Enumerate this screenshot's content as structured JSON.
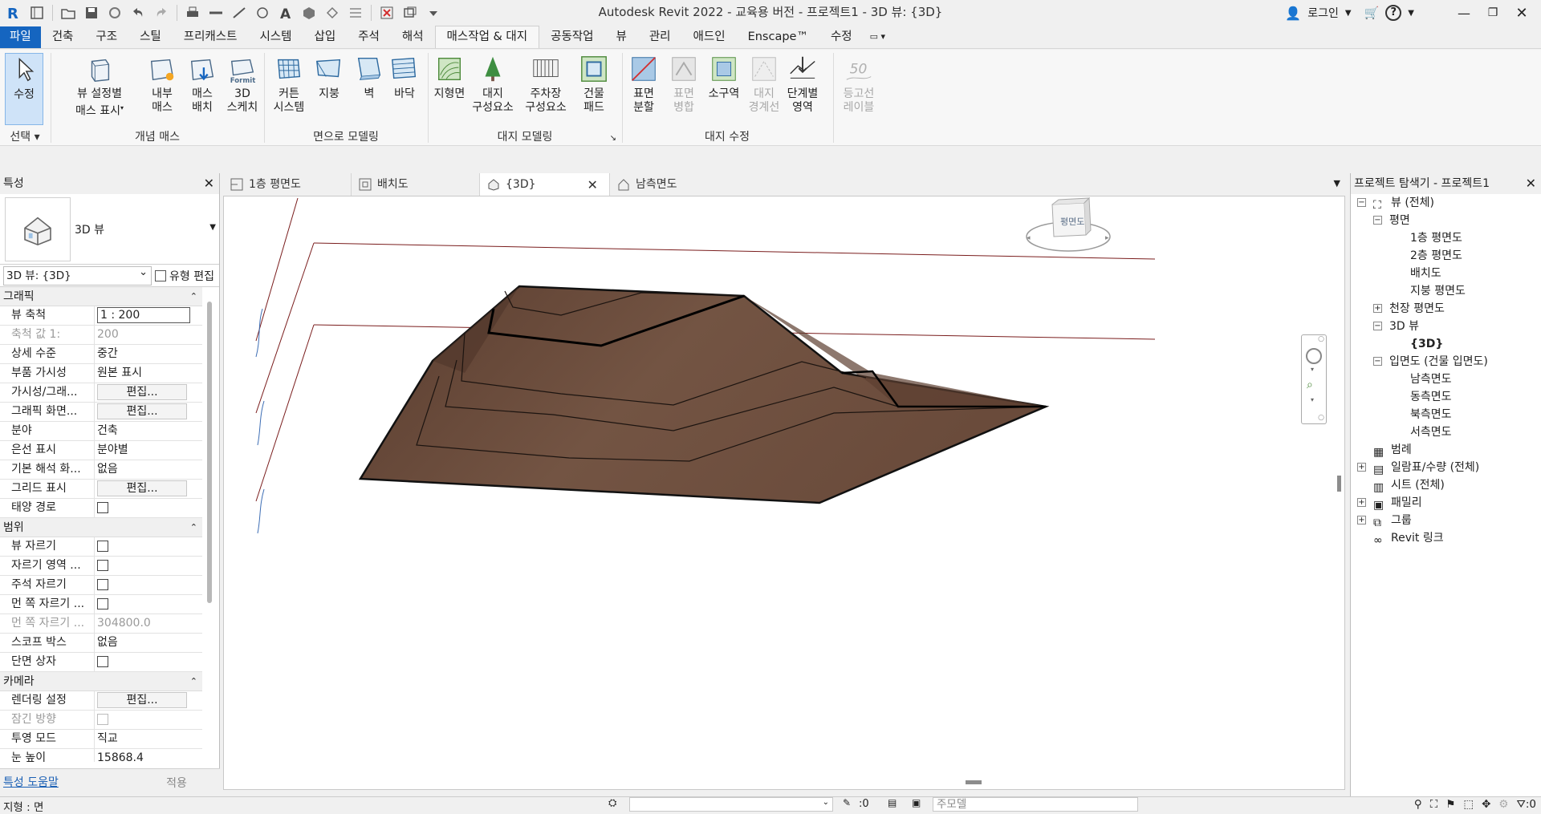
{
  "app": {
    "title": "Autodesk Revit 2022 - 교육용 버전 - 프로젝트1 - 3D 뷰: {3D}",
    "login_label": "로그인"
  },
  "quick_access": {
    "icons": [
      "revit-logo-icon",
      "home-icon",
      "open-icon",
      "save-icon",
      "sync-icon",
      "undo-icon",
      "redo-icon",
      "print-icon",
      "measure-icon",
      "dimension-icon",
      "tag-icon",
      "text-icon",
      "3d-view-icon",
      "section-icon",
      "thin-lines-icon",
      "close-hidden-icon",
      "switch-windows-icon",
      "customize-icon"
    ]
  },
  "ribbon_tabs": [
    "파일",
    "건축",
    "구조",
    "스틸",
    "프리캐스트",
    "시스템",
    "삽입",
    "주석",
    "해석",
    "매스작업 & 대지",
    "공동작업",
    "뷰",
    "관리",
    "애드인",
    "Enscape™",
    "수정"
  ],
  "active_tab": "매스작업 & 대지",
  "ribbon": {
    "select": {
      "modify_label": "수정",
      "panel_label": "선택"
    },
    "conceptual_mass": {
      "panel_label": "개념 매스",
      "buttons": [
        {
          "label": "뷰 설정별 매스 표시",
          "line1": "뷰 설정별",
          "line2": "매스 표시"
        },
        {
          "line1": "내부",
          "line2": "매스"
        },
        {
          "line1": "매스",
          "line2": "배치"
        },
        {
          "line1": "3D",
          "line2": "스케치"
        }
      ]
    },
    "model_by_face": {
      "panel_label": "면으로 모델링",
      "buttons": [
        {
          "line1": "커튼",
          "line2": "시스템"
        },
        {
          "line1": "지붕",
          "line2": ""
        },
        {
          "line1": "벽",
          "line2": ""
        },
        {
          "line1": "바닥",
          "line2": ""
        }
      ]
    },
    "site_modeling": {
      "panel_label": "대지 모델링",
      "buttons": [
        {
          "line1": "지형면",
          "line2": ""
        },
        {
          "line1": "대지",
          "line2": "구성요소"
        },
        {
          "line1": "주차장",
          "line2": "구성요소"
        },
        {
          "line1": "건물",
          "line2": "패드"
        }
      ]
    },
    "modify_site": {
      "panel_label": "대지 수정",
      "buttons": [
        {
          "line1": "표면",
          "line2": "분할",
          "disabled": false
        },
        {
          "line1": "표면",
          "line2": "병합",
          "disabled": true
        },
        {
          "line1": "소구역",
          "line2": "",
          "disabled": false
        },
        {
          "line1": "대지",
          "line2": "경계선",
          "disabled": true
        },
        {
          "line1": "단계별",
          "line2": "영역",
          "disabled": false
        },
        {
          "line1": "등고선",
          "line2": "레이블",
          "disabled": true
        }
      ]
    }
  },
  "properties": {
    "header": "특성",
    "type_name": "3D 뷰",
    "selector": "3D 뷰: {3D}",
    "edit_type": "유형 편집",
    "groups": [
      {
        "name": "그래픽",
        "rows": [
          {
            "key": "뷰 축척",
            "value": "1 : 200",
            "kind": "input"
          },
          {
            "key": "축척 값    1:",
            "value": "200",
            "kind": "text",
            "dim": true
          },
          {
            "key": "상세 수준",
            "value": "중간",
            "kind": "text"
          },
          {
            "key": "부품 가시성",
            "value": "원본 표시",
            "kind": "text"
          },
          {
            "key": "가시성/그래...",
            "value": "편집...",
            "kind": "button"
          },
          {
            "key": "그래픽 화면...",
            "value": "편집...",
            "kind": "button"
          },
          {
            "key": "분야",
            "value": "건축",
            "kind": "text"
          },
          {
            "key": "은선 표시",
            "value": "분야별",
            "kind": "text"
          },
          {
            "key": "기본 해석 화...",
            "value": "없음",
            "kind": "text"
          },
          {
            "key": "그리드 표시",
            "value": "편집...",
            "kind": "button"
          },
          {
            "key": "태양 경로",
            "value": "",
            "kind": "check"
          }
        ]
      },
      {
        "name": "범위",
        "rows": [
          {
            "key": "뷰 자르기",
            "value": "",
            "kind": "check"
          },
          {
            "key": "자르기 영역 ...",
            "value": "",
            "kind": "check"
          },
          {
            "key": "주석 자르기",
            "value": "",
            "kind": "check"
          },
          {
            "key": "먼 쪽 자르기 ...",
            "value": "",
            "kind": "check"
          },
          {
            "key": "먼 쪽 자르기 ...",
            "value": "304800.0",
            "kind": "text",
            "dim": true
          },
          {
            "key": "스코프 박스",
            "value": "없음",
            "kind": "text"
          },
          {
            "key": "단면 상자",
            "value": "",
            "kind": "check"
          }
        ]
      },
      {
        "name": "카메라",
        "rows": [
          {
            "key": "렌더링 설정",
            "value": "편집...",
            "kind": "button"
          },
          {
            "key": "잠긴 방향",
            "value": "",
            "kind": "checkdis",
            "dim": true
          },
          {
            "key": "투영 모드",
            "value": "직교",
            "kind": "text"
          },
          {
            "key": "눈 높이",
            "value": "15868.4",
            "kind": "text"
          }
        ]
      }
    ],
    "help_link": "특성 도움말",
    "apply": "적용"
  },
  "view_tabs": [
    {
      "label": "1층 평면도",
      "icon": "floor-plan-icon",
      "active": false
    },
    {
      "label": "배치도",
      "icon": "site-plan-icon",
      "active": false
    },
    {
      "label": "{3D}",
      "icon": "3d-view-icon",
      "active": true
    },
    {
      "label": "남측면도",
      "icon": "elevation-icon",
      "active": false
    }
  ],
  "viewcube": {
    "face_label": "평면도"
  },
  "project_browser": {
    "header": "프로젝트 탐색기 - 프로젝트1",
    "nodes": [
      {
        "text": "뷰 (전체)",
        "depth": 0,
        "toggle": "−",
        "icon": "views-icon"
      },
      {
        "text": "평면",
        "depth": 1,
        "toggle": "−"
      },
      {
        "text": "1층 평면도",
        "depth": 2
      },
      {
        "text": "2층 평면도",
        "depth": 2
      },
      {
        "text": "배치도",
        "depth": 2
      },
      {
        "text": "지붕 평면도",
        "depth": 2
      },
      {
        "text": "천장 평면도",
        "depth": 1,
        "toggle": "+"
      },
      {
        "text": "3D 뷰",
        "depth": 1,
        "toggle": "−"
      },
      {
        "text": "{3D}",
        "depth": 2,
        "bold": true
      },
      {
        "text": "입면도 (건물 입면도)",
        "depth": 1,
        "toggle": "−"
      },
      {
        "text": "남측면도",
        "depth": 2
      },
      {
        "text": "동측면도",
        "depth": 2
      },
      {
        "text": "북측면도",
        "depth": 2
      },
      {
        "text": "서측면도",
        "depth": 2
      },
      {
        "text": "범례",
        "depth": 0,
        "icon": "legend-icon"
      },
      {
        "text": "일람표/수량 (전체)",
        "depth": 0,
        "toggle": "+",
        "icon": "schedule-icon"
      },
      {
        "text": "시트 (전체)",
        "depth": 0,
        "icon": "sheet-icon"
      },
      {
        "text": "패밀리",
        "depth": 0,
        "toggle": "+",
        "icon": "family-icon"
      },
      {
        "text": "그룹",
        "depth": 0,
        "toggle": "+",
        "icon": "group-icon"
      },
      {
        "text": "Revit 링크",
        "depth": 0,
        "icon": "revit-link-icon"
      }
    ]
  },
  "status": {
    "text": "지형 : 면",
    "count1": ":0",
    "model_combo": "주모델",
    "filter_count": ":0"
  },
  "colors": {
    "file_tab": "#1565c0",
    "terrain": "#6b4b3a",
    "accent": "#86b6e8"
  }
}
